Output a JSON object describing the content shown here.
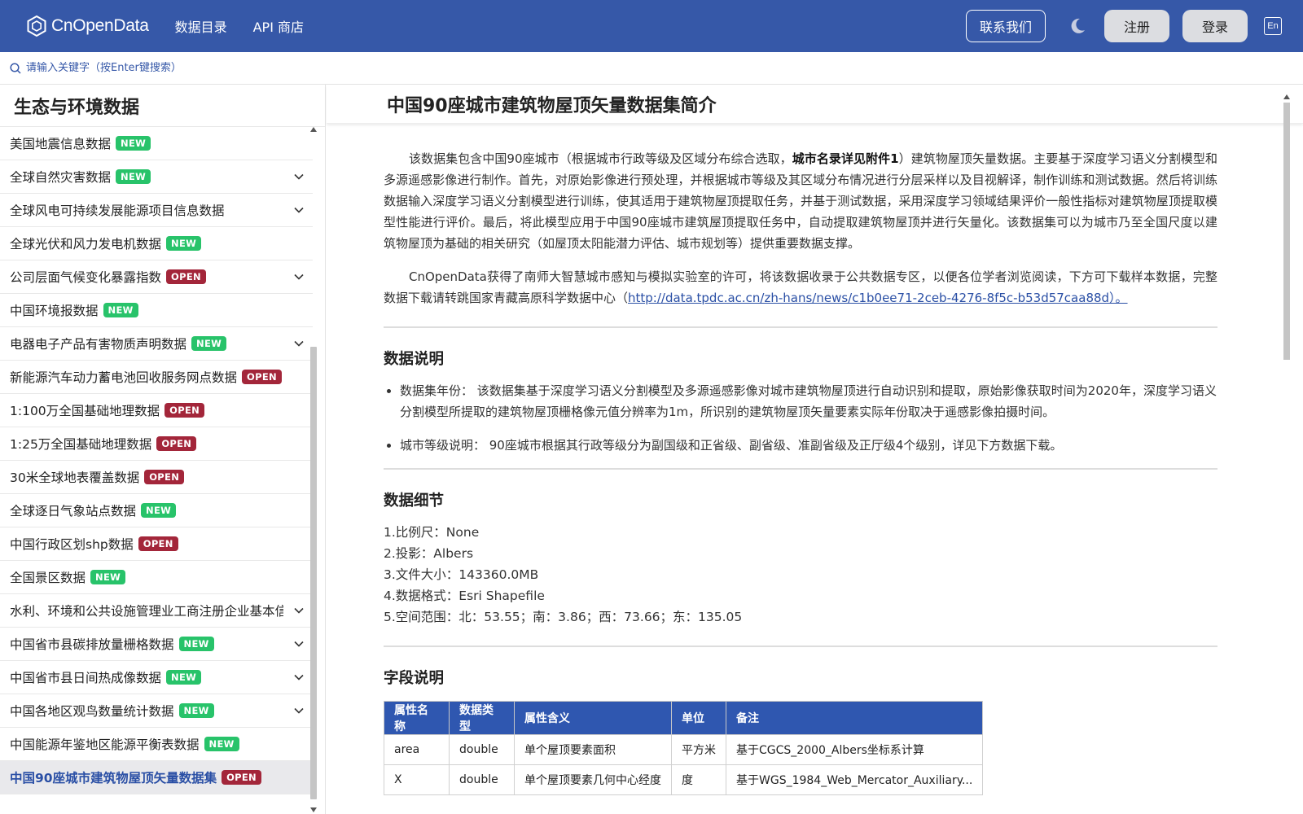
{
  "header": {
    "logo_text": "CnOpenData",
    "nav": [
      "数据目录",
      "API 商店"
    ],
    "contact_label": "联系我们",
    "register_label": "注册",
    "login_label": "登录",
    "lang_label": "En"
  },
  "search": {
    "placeholder": "请输入关键字（按Enter键搜索）"
  },
  "sidebar": {
    "title": "生态与环境数据",
    "items": [
      {
        "label": "美国地震信息数据",
        "badge": "NEW",
        "expandable": false
      },
      {
        "label": "全球自然灾害数据",
        "badge": "NEW",
        "expandable": true
      },
      {
        "label": "全球风电可持续发展能源项目信息数据",
        "badge": "",
        "expandable": true
      },
      {
        "label": "全球光伏和风力发电机数据",
        "badge": "NEW",
        "expandable": false
      },
      {
        "label": "公司层面气候变化暴露指数",
        "badge": "OPEN",
        "expandable": true
      },
      {
        "label": "中国环境报数据",
        "badge": "NEW",
        "expandable": false
      },
      {
        "label": "电器电子产品有害物质声明数据",
        "badge": "NEW",
        "expandable": true
      },
      {
        "label": "新能源汽车动力蓄电池回收服务网点数据",
        "badge": "OPEN",
        "expandable": false
      },
      {
        "label": "1:100万全国基础地理数据",
        "badge": "OPEN",
        "expandable": false
      },
      {
        "label": "1:25万全国基础地理数据",
        "badge": "OPEN",
        "expandable": false
      },
      {
        "label": "30米全球地表覆盖数据",
        "badge": "OPEN",
        "expandable": false
      },
      {
        "label": "全球逐日气象站点数据",
        "badge": "NEW",
        "expandable": false
      },
      {
        "label": "中国行政区划shp数据",
        "badge": "OPEN",
        "expandable": false
      },
      {
        "label": "全国景区数据",
        "badge": "NEW",
        "expandable": false
      },
      {
        "label": "水利、环境和公共设施管理业工商注册企业基本信息",
        "badge": "",
        "expandable": true
      },
      {
        "label": "中国省市县碳排放量栅格数据",
        "badge": "NEW",
        "expandable": true
      },
      {
        "label": "中国省市县日间热成像数据",
        "badge": "NEW",
        "expandable": true
      },
      {
        "label": "中国各地区观鸟数量统计数据",
        "badge": "NEW",
        "expandable": true
      },
      {
        "label": "中国能源年鉴地区能源平衡表数据",
        "badge": "NEW",
        "expandable": false
      },
      {
        "label": "中国90座城市建筑物屋顶矢量数据集",
        "badge": "OPEN",
        "expandable": false,
        "active": true
      }
    ]
  },
  "main": {
    "title": "中国90座城市建筑物屋顶矢量数据集简介",
    "intro_p1_a": "该数据集包含中国90座城市（根据城市行政等级及区域分布综合选取，",
    "intro_p1_bold": "城市名录详见附件1",
    "intro_p1_b": "）建筑物屋顶矢量数据。主要基于深度学习语义分割模型和多源遥感影像进行制作。首先，对原始影像进行预处理，并根据城市等级及其区域分布情况进行分层采样以及目视解译，制作训练和测试数据。然后将训练数据输入深度学习语义分割模型进行训练，使其适用于建筑物屋顶提取任务，并基于测试数据，采用深度学习领域结果评价一般性指标对建筑物屋顶提取模型性能进行评价。最后，将此模型应用于中国90座城市建筑屋顶提取任务中，自动提取建筑物屋顶并进行矢量化。该数据集可以为城市乃至全国尺度以建筑物屋顶为基础的相关研究（如屋顶太阳能潜力评估、城市规划等）提供重要数据支撑。",
    "intro_p2_a": "CnOpenData获得了南师大智慧城市感知与模拟实验室的许可，将该数据收录于公共数据专区，以便各位学者浏览阅读，下方可下载样本数据，完整数据下载请转跳国家青藏高原科学数据中心（",
    "intro_p2_link": "http://data.tpdc.ac.cn/zh-hans/news/c1b0ee71-2ceb-4276-8f5c-b53d57caa88d）。",
    "sections": {
      "explain_title": "数据说明",
      "explain_items": [
        "数据集年份：  该数据集基于深度学习语义分割模型及多源遥感影像对城市建筑物屋顶进行自动识别和提取，原始影像获取时间为2020年，深度学习语义分割模型所提取的建筑物屋顶栅格像元值分辨率为1m，所识别的建筑物屋顶矢量要素实际年份取决于遥感影像拍摄时间。",
        "城市等级说明：  90座城市根据其行政等级分为副国级和正省级、副省级、准副省级及正厅级4个级别，详见下方数据下载。"
      ],
      "detail_title": "数据细节",
      "detail_lines": [
        "1.比例尺：None",
        "2.投影：Albers",
        "3.文件大小：143360.0MB",
        "4.数据格式：Esri Shapefile",
        "5.空间范围：北：53.55；南：3.86；西：73.66；东：135.05"
      ],
      "field_title": "字段说明",
      "table": {
        "headers": [
          "属性名称",
          "数据类型",
          "属性含义",
          "单位",
          "备注"
        ],
        "rows": [
          [
            "area",
            "double",
            "单个屋顶要素面积",
            "平方米",
            "基于CGCS_2000_Albers坐标系计算"
          ],
          [
            "X",
            "double",
            "单个屋顶要素几何中心经度",
            "度",
            "基于WGS_1984_Web_Mercator_Auxiliary..."
          ]
        ]
      }
    }
  }
}
